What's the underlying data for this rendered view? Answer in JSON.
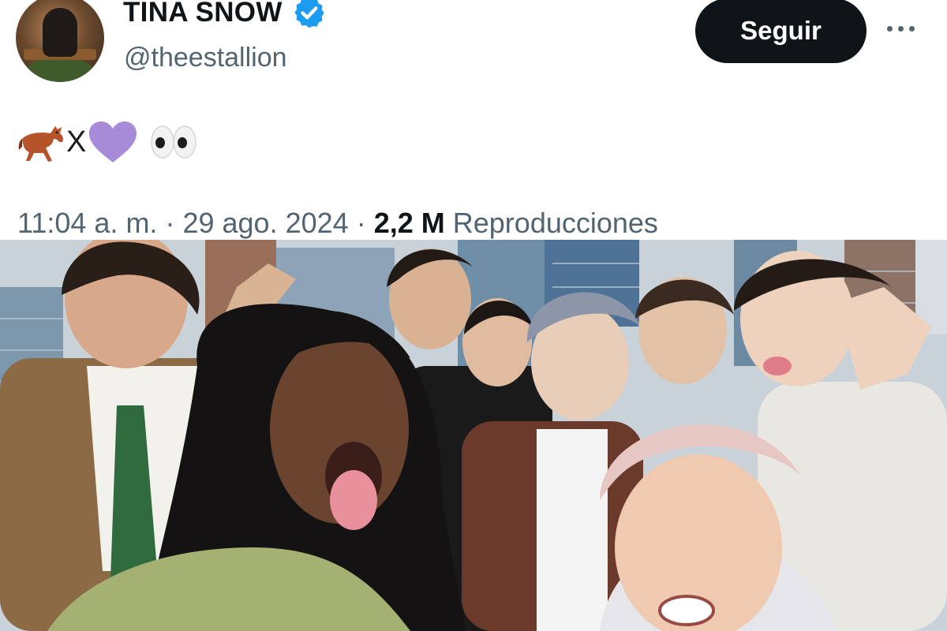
{
  "user": {
    "display_name": "TINA SNOW",
    "handle": "@theestallion",
    "verified": true
  },
  "actions": {
    "follow_label": "Seguir"
  },
  "tweet": {
    "text_letter": "X",
    "emoji": [
      "horse-icon",
      "purple-heart-icon",
      "eyes-icon"
    ]
  },
  "meta": {
    "time": "11:04 a. m.",
    "separator": "·",
    "date": "29 ago. 2024",
    "views_count": "2,2 M",
    "views_label": "Reproducciones"
  },
  "colors": {
    "follow_bg": "#0f1419",
    "verified_blue": "#1d9bf0",
    "secondary_text": "#536471",
    "purple_heart": "#a78bd8",
    "horse_brown": "#b5532a"
  }
}
